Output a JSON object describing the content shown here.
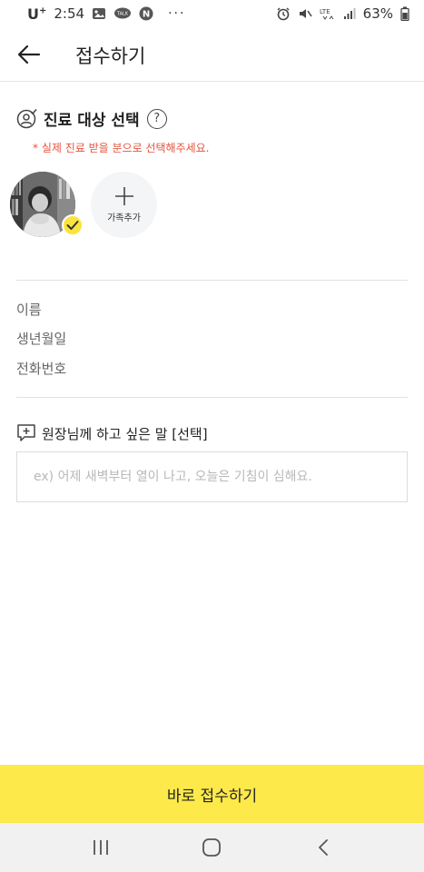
{
  "status_bar": {
    "carrier": "U",
    "carrier_sup": "+",
    "time": "2:54",
    "notif_talk": "TALK",
    "notif_n": "N",
    "more": "···",
    "lte": "LTE",
    "battery": "63%"
  },
  "header": {
    "title": "접수하기"
  },
  "patient": {
    "section_title": "진료 대상 선택",
    "help": "?",
    "notice": "* 실제 진료 받을 분으로 선택해주세요.",
    "add_family_label": "가족추가"
  },
  "info": {
    "name_label": "이름",
    "birth_label": "생년월일",
    "phone_label": "전화번호"
  },
  "memo": {
    "title": "원장님께 하고 싶은 말 [선택]",
    "value": "",
    "placeholder": "ex) 어제 새벽부터 열이 나고, 오늘은 기침이 심해요."
  },
  "footer": {
    "submit_label": "바로 접수하기"
  },
  "colors": {
    "accent_yellow": "#fde94a",
    "notice_red": "#e5533d",
    "divider": "#e3e3e3"
  },
  "icons": {
    "back": "arrow-left-icon",
    "patient": "user-check-icon",
    "help": "question-circle-icon",
    "add": "plus-icon",
    "check": "check-icon",
    "memo": "message-plus-icon",
    "nav_recent": "recent-apps-icon",
    "nav_home": "home-icon",
    "nav_back": "chevron-left-icon"
  }
}
